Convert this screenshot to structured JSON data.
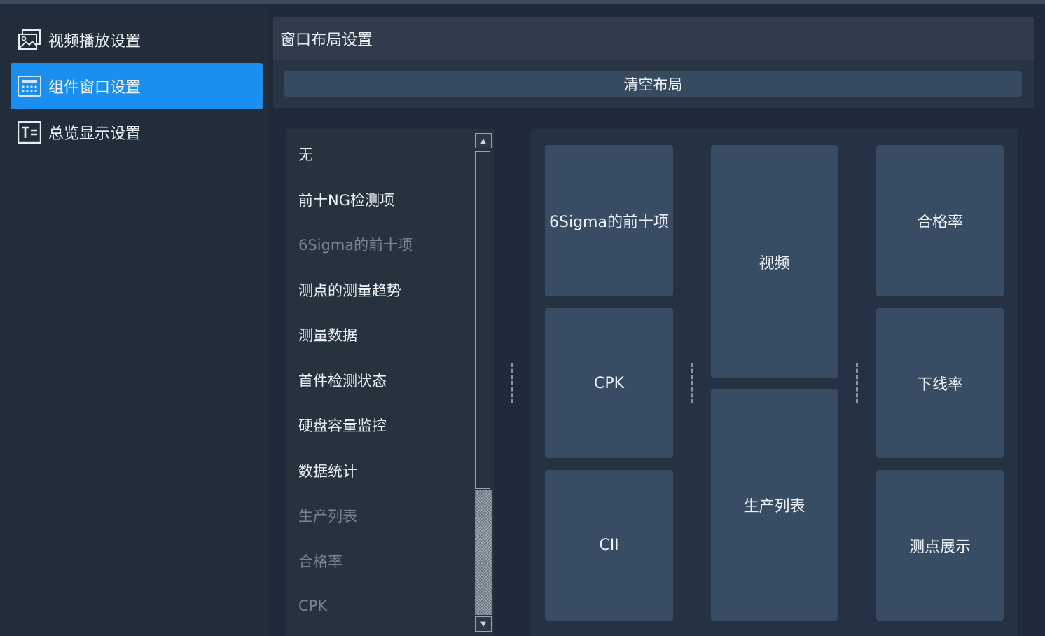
{
  "sidebar": {
    "items": [
      {
        "label": "视频播放设置",
        "icon": "image-icon",
        "active": false
      },
      {
        "label": "组件窗口设置",
        "icon": "widget-grid-icon",
        "active": true
      },
      {
        "label": "总览显示设置",
        "icon": "text-box-icon",
        "active": false
      }
    ]
  },
  "header": {
    "title": "窗口布局设置"
  },
  "toolbar": {
    "clear_label": "清空布局"
  },
  "component_list": {
    "items": [
      {
        "label": "无",
        "enabled": true
      },
      {
        "label": "前十NG检测项",
        "enabled": true
      },
      {
        "label": "6Sigma的前十项",
        "enabled": false
      },
      {
        "label": "测点的测量趋势",
        "enabled": true
      },
      {
        "label": "测量数据",
        "enabled": true
      },
      {
        "label": "首件检测状态",
        "enabled": true
      },
      {
        "label": "硬盘容量监控",
        "enabled": true
      },
      {
        "label": "数据统计",
        "enabled": true
      },
      {
        "label": "生产列表",
        "enabled": false
      },
      {
        "label": "合格率",
        "enabled": false
      },
      {
        "label": "CPK",
        "enabled": false
      }
    ]
  },
  "layout": {
    "column_1": [
      "6Sigma的前十项",
      "CPK",
      "CII"
    ],
    "column_2": [
      "视频",
      "生产列表"
    ],
    "column_3": [
      "合格率",
      "下线率",
      "测点展示"
    ]
  },
  "colors": {
    "accent": "#1a8ff0",
    "tile": "#384d64",
    "disabled_text": "#7a8594"
  }
}
